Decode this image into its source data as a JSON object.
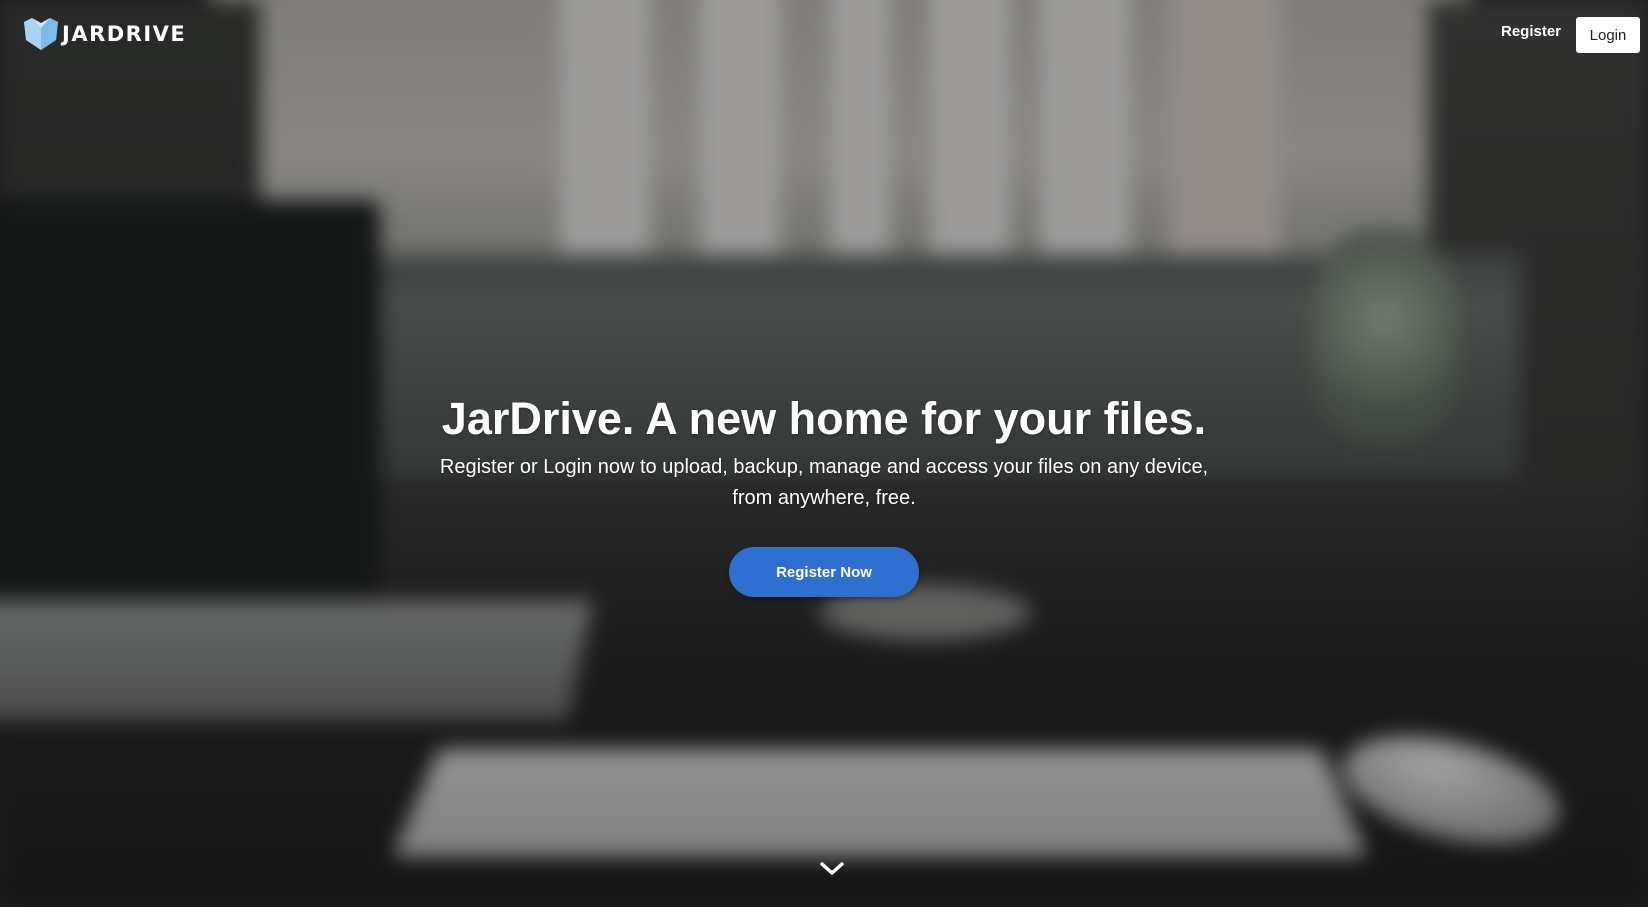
{
  "header": {
    "brand_name": "JARDRIVE",
    "logo_icon": "jar-logo-icon",
    "nav": {
      "register_label": "Register",
      "login_label": "Login"
    }
  },
  "hero": {
    "title": "JarDrive. A new home for your files.",
    "subtitle": "Register or Login now to upload, backup, manage and access your files on any device, from anywhere, free.",
    "cta_label": "Register Now",
    "scroll_icon": "chevron-down-icon"
  },
  "colors": {
    "cta_background": "#2f6fd0",
    "logo_light": "#a9d4f2",
    "logo_dark": "#5ea6dd",
    "login_background": "#ffffff"
  }
}
